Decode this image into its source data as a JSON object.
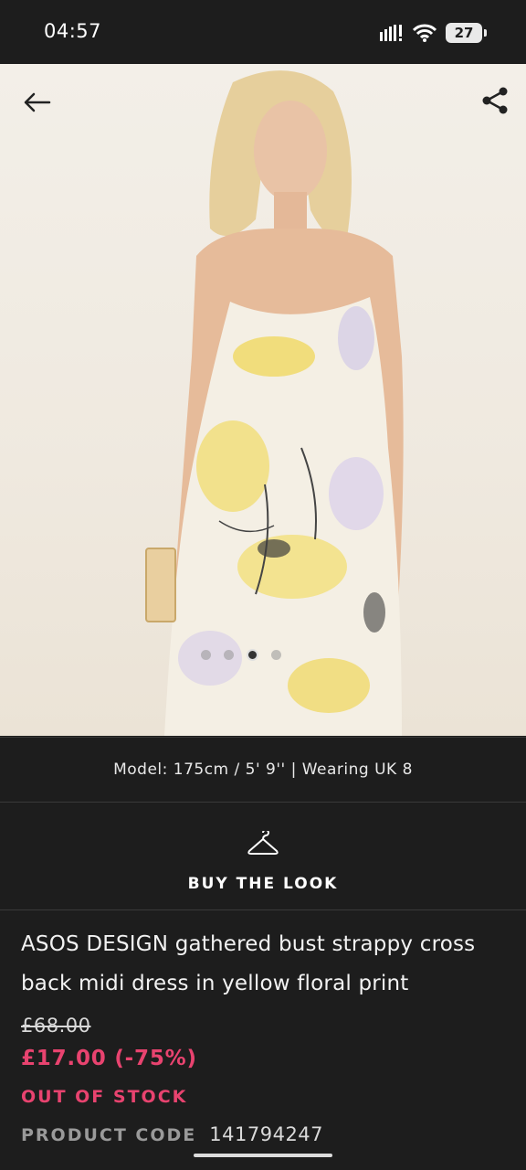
{
  "status_bar": {
    "time": "04:57",
    "battery": "27",
    "icons": [
      "signal-icon",
      "wifi-icon",
      "battery-icon"
    ]
  },
  "hero": {
    "back_icon": "arrow-left-icon",
    "share_icon": "share-icon",
    "carousel": {
      "count": 4,
      "active_index": 2
    }
  },
  "model_info": "Model: 175cm / 5' 9'' | Wearing UK 8",
  "buy_the_look": {
    "icon": "hanger-icon",
    "label": "BUY THE LOOK"
  },
  "product": {
    "title_line1": "ASOS DESIGN gathered bust strappy cross",
    "title_line2": "back midi dress in yellow floral print",
    "price_old": "£68.00",
    "price_now": "£17.00 (-75%)",
    "stock_status": "OUT OF STOCK",
    "code_label": "PRODUCT CODE",
    "code_value": "141794247"
  },
  "colors": {
    "background": "#1d1d1d",
    "sale_pink": "#e8436f",
    "text": "#f2f2f2"
  }
}
